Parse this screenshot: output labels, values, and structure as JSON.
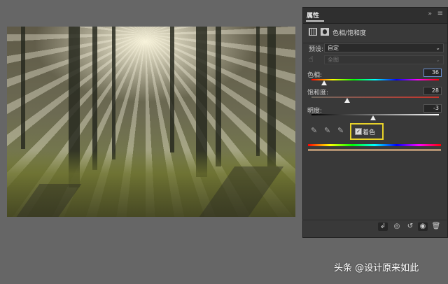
{
  "panel": {
    "tab_title": "属性",
    "collapse_glyph": "»",
    "menu_glyph": "≡",
    "adjustment_title": "色相/饱和度",
    "adjustment_icon": "hue-saturation-layer-icon",
    "mask_icon": "layer-mask-icon",
    "preset": {
      "label": "预设:",
      "value": "自定"
    },
    "channel": {
      "value": "全图"
    },
    "hue": {
      "label": "色相:",
      "value": "36",
      "min": -180,
      "max": 180
    },
    "saturation": {
      "label": "饱和度:",
      "value": "28",
      "min": 0,
      "max": 100
    },
    "lightness": {
      "label": "明度:",
      "value": "-3",
      "min": -100,
      "max": 100
    },
    "colorize": {
      "label": "着色",
      "checked": true,
      "highlight_color": "#e8d22a"
    },
    "tone_bar_color": "#b09070",
    "bottom_buttons": [
      {
        "name": "clip-to-layer-icon",
        "glyph": "↲"
      },
      {
        "name": "view-previous-state-icon",
        "glyph": "◎"
      },
      {
        "name": "reset-icon",
        "glyph": "↺"
      },
      {
        "name": "visibility-icon",
        "glyph": "◉"
      },
      {
        "name": "trash-icon",
        "glyph": "🗑"
      }
    ]
  },
  "watermark": "头条 @设计原来如此"
}
